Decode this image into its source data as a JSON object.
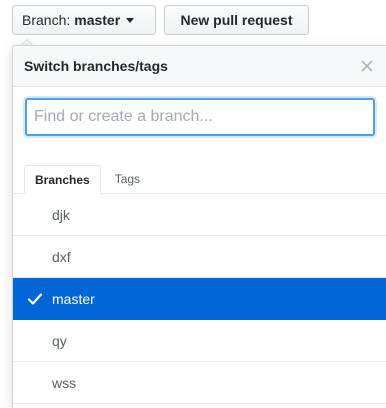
{
  "toolbar": {
    "branch_prefix": "Branch:",
    "branch_value": "master",
    "new_pull_request_label": "New pull request"
  },
  "dropdown": {
    "title": "Switch branches/tags",
    "filter_placeholder": "Find or create a branch...",
    "filter_value": "",
    "tabs": [
      {
        "label": "Branches",
        "active": true
      },
      {
        "label": "Tags",
        "active": false
      }
    ],
    "branches": [
      {
        "name": "djk",
        "selected": false
      },
      {
        "name": "dxf",
        "selected": false
      },
      {
        "name": "master",
        "selected": true
      },
      {
        "name": "qy",
        "selected": false
      },
      {
        "name": "wss",
        "selected": false
      }
    ]
  },
  "colors": {
    "accent": "#0366d6",
    "focus_border": "#4aa3e8"
  },
  "icons": {
    "caret": "triangle-down-icon",
    "close": "close-icon",
    "check": "check-icon"
  }
}
